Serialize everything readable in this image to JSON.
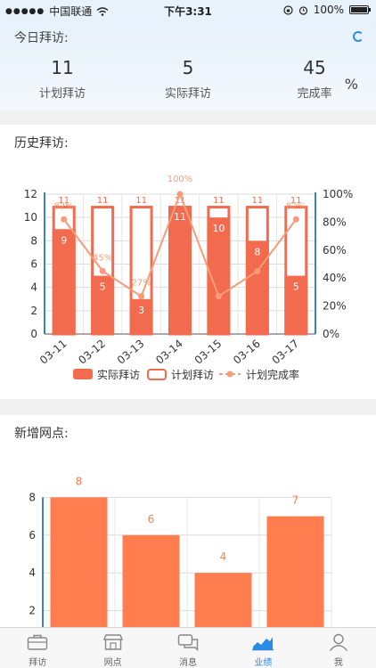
{
  "status_bar": {
    "carrier": "中国联通",
    "time": "下午3:31",
    "battery": "100%"
  },
  "today": {
    "title": "今日拜访:",
    "planned": {
      "value": "11",
      "label": "计划拜访"
    },
    "actual": {
      "value": "5",
      "label": "实际拜访"
    },
    "rate": {
      "value": "45",
      "label": "完成率"
    },
    "rate_unit": "%"
  },
  "history": {
    "title": "历史拜访:",
    "legend": {
      "actual": "实际拜访",
      "planned": "计划拜访",
      "rate": "计划完成率"
    }
  },
  "new_outlets": {
    "title": "新增网点:"
  },
  "chart_data": [
    {
      "type": "bar",
      "categories": [
        "03-11",
        "03-12",
        "03-13",
        "03-14",
        "03-15",
        "03-16",
        "03-17"
      ],
      "series": [
        {
          "name": "实际拜访",
          "type": "bar",
          "values": [
            9,
            5,
            3,
            11,
            10,
            8,
            5
          ]
        },
        {
          "name": "计划拜访",
          "type": "bar",
          "values": [
            11,
            11,
            11,
            11,
            11,
            11,
            11
          ]
        },
        {
          "name": "计划完成率",
          "type": "line",
          "axis": "right",
          "values": [
            82,
            45,
            27,
            100,
            27,
            45,
            82
          ]
        }
      ],
      "rate_labels": [
        "82%",
        "45%",
        "27%",
        "100%",
        "",
        "",
        "82%"
      ],
      "ylim": [
        0,
        12
      ],
      "yticks": [
        "0",
        "2",
        "4",
        "6",
        "8",
        "10",
        "12"
      ],
      "y2lim": [
        0,
        100
      ],
      "y2ticks": [
        "0%",
        "20%",
        "40%",
        "60%",
        "80%",
        "100%"
      ],
      "legend_position": "bottom",
      "colors": {
        "actual": "#f26b4e",
        "planned_border": "#f26b4e",
        "rate": "#f79b7a"
      }
    },
    {
      "type": "bar",
      "categories": [
        "",
        "",
        "",
        ""
      ],
      "values": [
        8,
        6,
        4,
        7
      ],
      "yticks": [
        "2",
        "4",
        "6",
        "8"
      ],
      "colors": {
        "bar": "#ff7d4f"
      }
    }
  ],
  "tabs": [
    {
      "label": "拜访",
      "icon": "briefcase-icon",
      "active": false
    },
    {
      "label": "网点",
      "icon": "store-icon",
      "active": false
    },
    {
      "label": "消息",
      "icon": "chat-icon",
      "active": false
    },
    {
      "label": "业绩",
      "icon": "trend-chart-icon",
      "active": true
    },
    {
      "label": "我",
      "icon": "person-icon",
      "active": false
    }
  ]
}
